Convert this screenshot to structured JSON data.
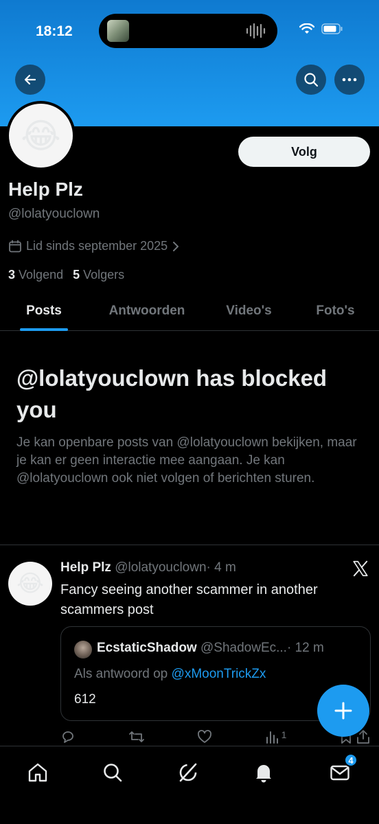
{
  "status_bar": {
    "time": "18:12"
  },
  "profile": {
    "avatar_emoji": "😂",
    "display_name": "Help Plz",
    "handle": "@lolatyouclown",
    "joined": "Lid sinds september 2025",
    "following_count": "3",
    "following_label": "Volgend",
    "followers_count": "5",
    "followers_label": "Volgers",
    "follow_button": "Volg"
  },
  "tabs": [
    {
      "label": "Posts",
      "active": true
    },
    {
      "label": "Antwoorden",
      "active": false
    },
    {
      "label": "Video's",
      "active": false
    },
    {
      "label": "Foto's",
      "active": false
    }
  ],
  "blocked": {
    "title": "@lolatyouclown has blocked you",
    "text": "Je kan openbare posts van @lolatyouclown bekijken, maar je kan er geen interactie mee aangaan. Je kan @lolatyouclown ook niet volgen of berichten sturen."
  },
  "post": {
    "avatar_emoji": "😂",
    "name": "Help Plz",
    "handle": "@lolatyouclown",
    "time": "· 4 m",
    "text": "Fancy seeing another scammer in another scammers post",
    "quote": {
      "name": "EcstaticShadow",
      "handle": "@ShadowEc...",
      "time": "· 12 m",
      "reply_prefix": "Als antwoord op",
      "reply_handle": "@xMoonTrickZx",
      "text": "612"
    },
    "views_count": "1"
  },
  "nav": {
    "messages_badge": "4"
  },
  "colors": {
    "accent": "#1d9bf0",
    "background": "#000000",
    "muted": "#71767b",
    "text": "#e7e9ea"
  }
}
